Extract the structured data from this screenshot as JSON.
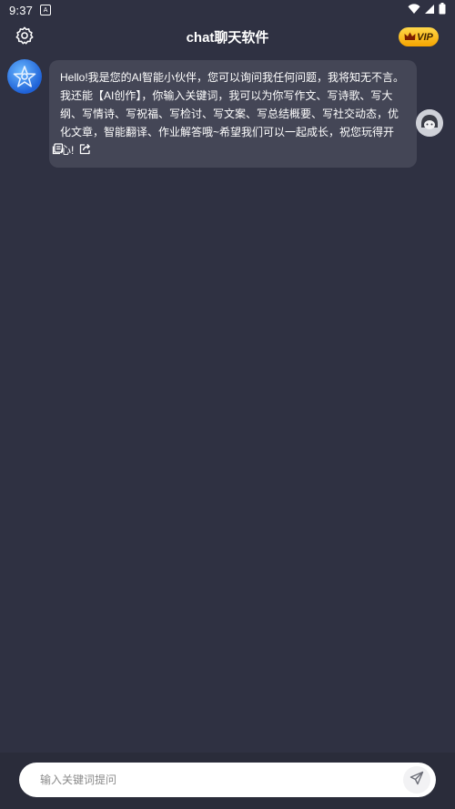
{
  "status_bar": {
    "time": "9:37",
    "icons": [
      "app-notification-icon",
      "wifi-icon",
      "cellular-signal-icon",
      "battery-icon"
    ]
  },
  "header": {
    "title": "chat聊天软件",
    "settings_icon": "gear-icon",
    "vip_label": "VIP",
    "vip_icon": "crown-icon"
  },
  "chat": {
    "messages": [
      {
        "sender": "bot",
        "text": "Hello!我是您的AI智能小伙伴，您可以询问我任何问题，我将知无不言。我还能【AI创作】，你输入关键词，我可以为你写作文、写诗歌、写大纲、写情诗、写祝福、写检讨、写文案、写总结概要、写社交动态，优化文章，智能翻译、作业解答哦~希望我们可以一起成长，祝您玩得开心!",
        "actions": [
          "copy-icon",
          "share-icon"
        ]
      }
    ]
  },
  "composer": {
    "placeholder": "输入关键词提问",
    "value": "",
    "send_icon": "send-icon"
  },
  "colors": {
    "background": "#2f3142",
    "bubble": "#444656",
    "bottom_bar": "#2a2c3a",
    "vip_gold": "#f5b400"
  }
}
